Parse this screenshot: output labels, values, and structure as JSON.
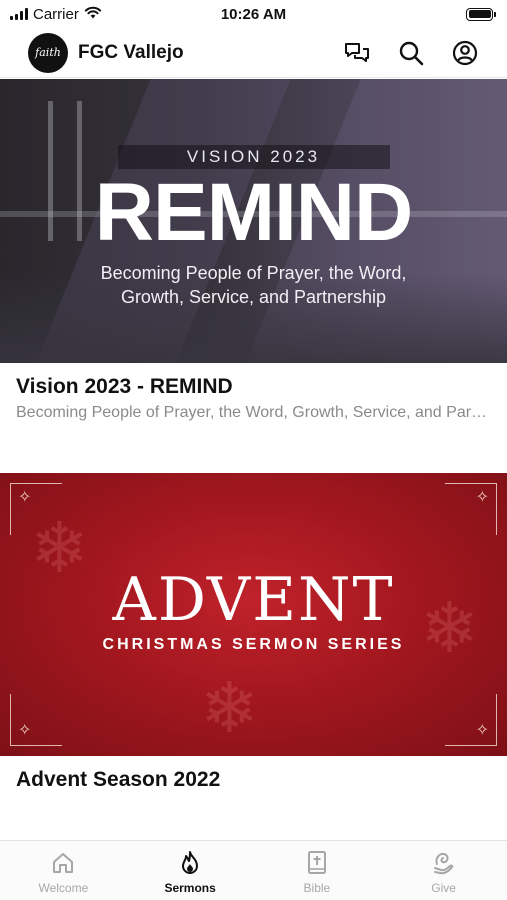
{
  "status_bar": {
    "carrier": "Carrier",
    "time": "10:26 AM",
    "icons": [
      "signal-icon",
      "wifi-icon",
      "battery-icon"
    ]
  },
  "header": {
    "logo_text": "faith",
    "title": "FGC Vallejo",
    "actions": [
      "chat-icon",
      "search-icon",
      "account-icon"
    ]
  },
  "sermons": [
    {
      "banner": {
        "kicker": "VISION 2023",
        "title": "REMIND",
        "subtitle_line1": "Becoming People of Prayer, the Word,",
        "subtitle_line2": "Growth, Service, and Partnership"
      },
      "title": "Vision 2023 - REMIND",
      "subtitle": "Becoming People of Prayer, the Word, Growth, Service, and Partnership"
    },
    {
      "banner": {
        "title": "ADVENT",
        "subtitle": "CHRISTMAS SERMON SERIES"
      },
      "title": "Advent Season 2022"
    }
  ],
  "tabs": [
    {
      "label": "Welcome",
      "icon": "home-icon",
      "active": false
    },
    {
      "label": "Sermons",
      "icon": "flame-icon",
      "active": true
    },
    {
      "label": "Bible",
      "icon": "bible-icon",
      "active": false
    },
    {
      "label": "Give",
      "icon": "give-icon",
      "active": false
    }
  ],
  "colors": {
    "tab_active": "#111111",
    "tab_inactive": "#a7a7a7",
    "subtitle_gray": "#8a8a8a",
    "advent_red": "#a3171f"
  }
}
